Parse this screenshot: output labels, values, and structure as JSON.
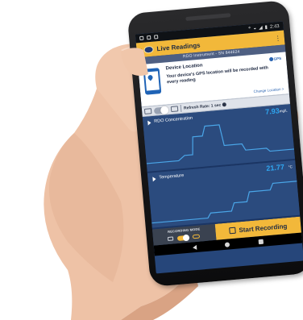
{
  "status_bar": {
    "time": "2:43"
  },
  "app_bar": {
    "back_icon": "chevron-left-icon",
    "title": "Live Readings",
    "menu_icon": "more-vert-icon"
  },
  "instrument": {
    "label": "RDO Instrument - SN 844624"
  },
  "location_card": {
    "heading": "Device Location",
    "gps_label": "GPS",
    "description": "Your device's GPS location will be recorded with every reading",
    "change_link": "Change Location >"
  },
  "toolbar": {
    "refresh_label": "Refresh Rate: 1 sec"
  },
  "charts": [
    {
      "label": "RDO Concentration",
      "value": "7.93",
      "unit": "mg/L"
    },
    {
      "label": "Temperature",
      "value": "21.77",
      "unit": "°C"
    }
  ],
  "bottom_bar": {
    "mode_label": "RECORDING MODE",
    "record_label": "Start Recording"
  },
  "colors": {
    "accent": "#f2b83a",
    "screen_bg": "#2b4b7e",
    "value_blue": "#2fa6f0"
  }
}
